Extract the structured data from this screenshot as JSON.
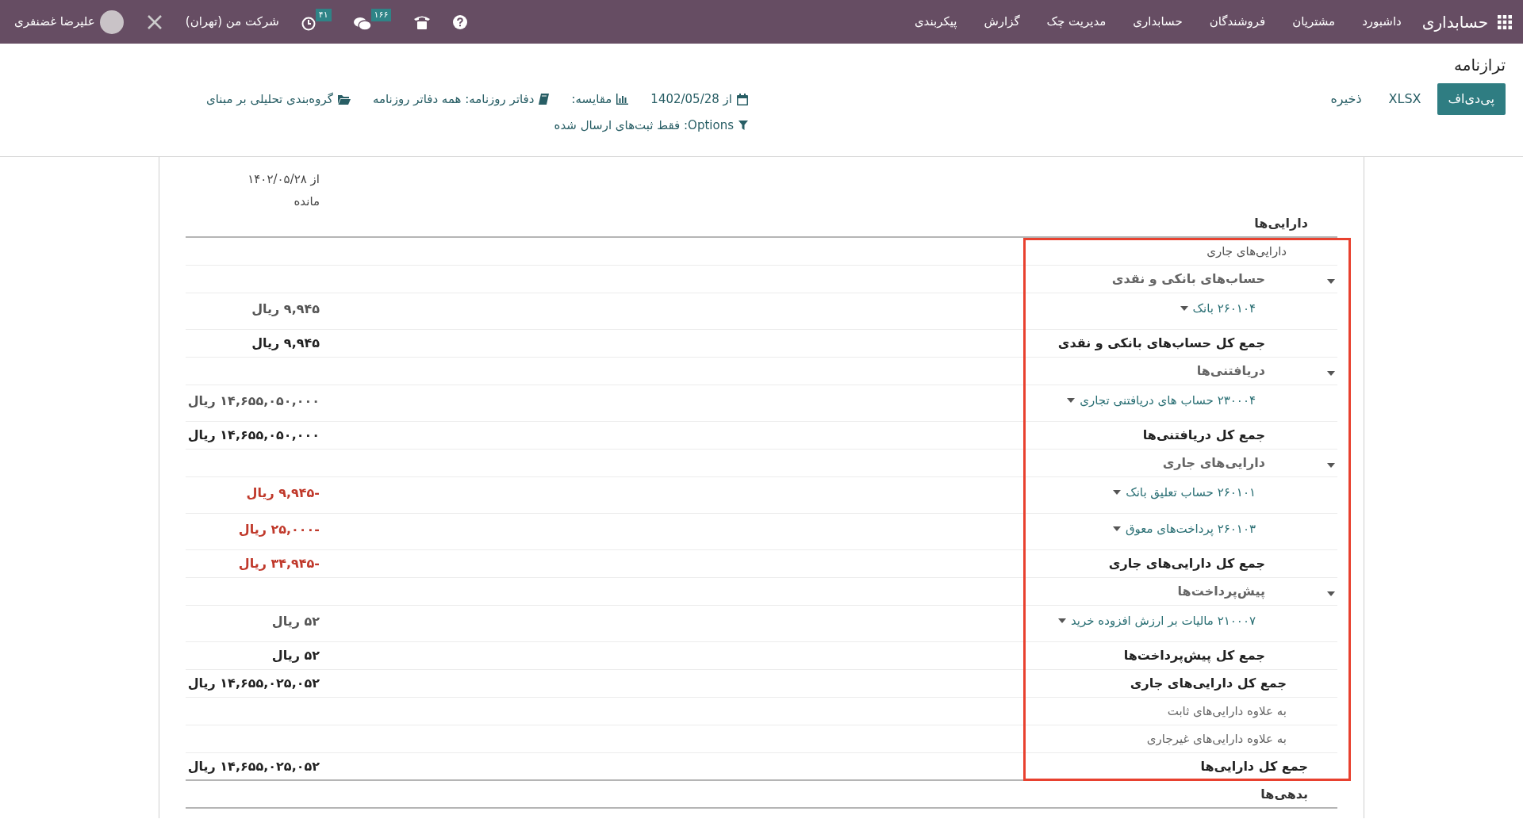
{
  "navbar": {
    "app_title": "حسابداری",
    "menu": [
      "داشبورد",
      "مشتریان",
      "فروشندگان",
      "حسابداری",
      "مدیریت چک",
      "گزارش",
      "پیکربندی"
    ],
    "messages_badge": "۱۶۶",
    "activities_badge": "۴۱",
    "company": "شرکت من (تهران)",
    "user": "علیرضا غضنفری"
  },
  "page_title": "ترازنامه",
  "actions": [
    {
      "label": "پی‌دی‌اف",
      "primary": true
    },
    {
      "label": "XLSX",
      "primary": false
    },
    {
      "label": "ذخیره",
      "primary": false
    }
  ],
  "filters": [
    {
      "kind": "date",
      "label": "از 1402/05/28"
    },
    {
      "kind": "comparison",
      "label": "مقایسه:"
    },
    {
      "kind": "journals",
      "label": "دفاتر روزنامه: همه دفاتر روزنامه"
    },
    {
      "kind": "analytic",
      "label": "گروه‌بندی تحلیلی بر مبنای"
    }
  ],
  "options": "Options: فقط ثبت‌های ارسال شده",
  "report": {
    "column_header": [
      "از ۱۴۰۲/۰۵/۲۸",
      "مانده"
    ],
    "rows": [
      {
        "kind": "heading",
        "label": "دارایی‌ها",
        "children": [
          {
            "kind": "heading",
            "label": "دارایی‌های جاری",
            "children": [
              {
                "kind": "group",
                "label": "حساب‌های بانکی و نقدی",
                "expanded": true,
                "children": [
                  {
                    "kind": "account",
                    "label": "۲۶۰۱۰۴ بانک",
                    "value": "۹,۹۴۵ ریال",
                    "negative": false
                  }
                ]
              },
              {
                "kind": "total",
                "label": "جمع کل حساب‌های بانکی و نقدی",
                "value": "۹,۹۴۵ ریال",
                "negative": false
              },
              {
                "kind": "group",
                "label": "دریافتنی‌ها",
                "expanded": true,
                "children": [
                  {
                    "kind": "account",
                    "label": "۲۳۰۰۰۴ حساب های دریافتنی تجاری",
                    "value": "۱۴,۶۵۵,۰۵۰,۰۰۰ ریال",
                    "negative": false
                  }
                ]
              },
              {
                "kind": "total",
                "label": "جمع کل دریافتنی‌ها",
                "value": "۱۴,۶۵۵,۰۵۰,۰۰۰ ریال",
                "negative": false
              },
              {
                "kind": "group",
                "label": "دارایی‌های جاری",
                "expanded": true,
                "children": [
                  {
                    "kind": "account",
                    "label": "۲۶۰۱۰۱ حساب تعلیق بانک",
                    "value": "-۹,۹۴۵ ریال",
                    "negative": true
                  },
                  {
                    "kind": "account",
                    "label": "۲۶۰۱۰۳ پرداخت‌های معوق",
                    "value": "-۲۵,۰۰۰ ریال",
                    "negative": true
                  }
                ]
              },
              {
                "kind": "total",
                "label": "جمع کل دارایی‌های جاری",
                "value": "-۳۴,۹۴۵ ریال",
                "negative": true
              },
              {
                "kind": "group",
                "label": "پیش‌پرداخت‌ها",
                "expanded": true,
                "children": [
                  {
                    "kind": "account",
                    "label": "۲۱۰۰۰۷ مالیات بر ارزش افزوده خرید",
                    "value": "۵۲ ریال",
                    "negative": false
                  }
                ]
              },
              {
                "kind": "total",
                "label": "جمع کل پیش‌پرداخت‌ها",
                "value": "۵۲ ریال",
                "negative": false
              }
            ]
          },
          {
            "kind": "total",
            "label": "جمع کل دارایی‌های جاری",
            "value": "۱۴,۶۵۵,۰۲۵,۰۵۲ ریال",
            "negative": false
          },
          {
            "kind": "plain",
            "label": "به علاوه دارایی‌های ثابت"
          },
          {
            "kind": "plain",
            "label": "به علاوه دارایی‌های غیرجاری"
          }
        ]
      },
      {
        "kind": "total",
        "label": "جمع کل دارایی‌ها",
        "value": "۱۴,۶۵۵,۰۲۵,۰۵۲ ریال",
        "negative": false
      },
      {
        "kind": "heading",
        "label": "بدهی‌ها"
      }
    ]
  }
}
